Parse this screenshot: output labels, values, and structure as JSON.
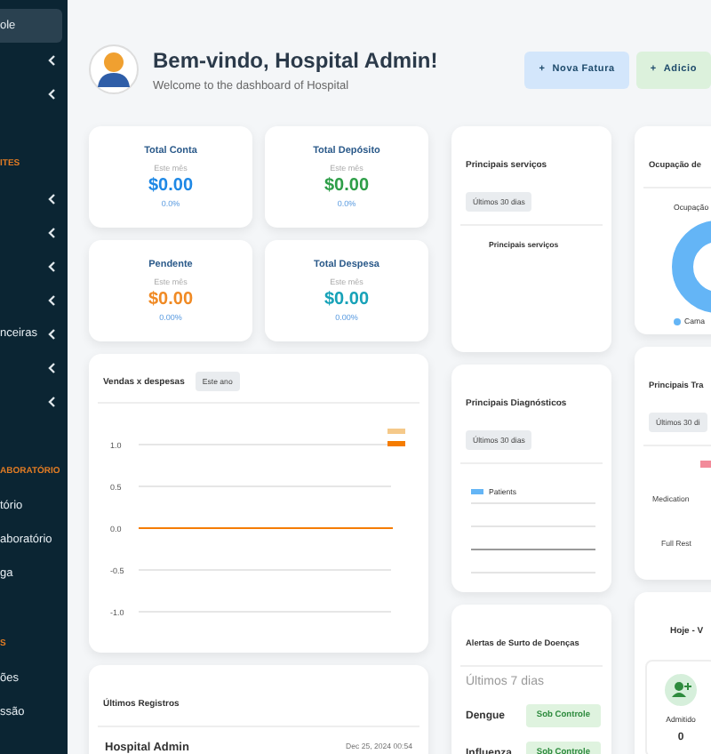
{
  "sidebar": {
    "items": [
      {
        "kind": "item",
        "label": "ole",
        "chevron": false,
        "selected": true
      },
      {
        "kind": "item",
        "chevron": true,
        "selected": false
      },
      {
        "kind": "item",
        "chevron": true,
        "selected": false
      },
      {
        "kind": "section",
        "label": "ITES"
      },
      {
        "kind": "item",
        "chevron": true,
        "selected": false
      },
      {
        "kind": "item",
        "chevron": true,
        "selected": false
      },
      {
        "kind": "item",
        "chevron": true,
        "selected": false
      },
      {
        "kind": "item",
        "chevron": true,
        "selected": false
      },
      {
        "kind": "item",
        "label": "nceiras",
        "chevron": true,
        "selected": false
      },
      {
        "kind": "item",
        "chevron": true,
        "selected": false
      },
      {
        "kind": "item",
        "chevron": true,
        "selected": false
      },
      {
        "kind": "section",
        "label": "ABORATÓRIO"
      },
      {
        "kind": "item",
        "label": "tório",
        "chevron": false,
        "selected": false
      },
      {
        "kind": "item",
        "label": "aboratório",
        "chevron": false,
        "selected": false
      },
      {
        "kind": "item",
        "label": "ga",
        "chevron": false,
        "selected": false
      },
      {
        "kind": "section",
        "label": "S"
      },
      {
        "kind": "item",
        "label": "ões",
        "chevron": false,
        "selected": false
      },
      {
        "kind": "item",
        "label": "ssão",
        "chevron": false,
        "selected": false
      }
    ]
  },
  "header": {
    "title": "Bem-vindo, Hospital Admin!",
    "subtitle": "Welcome to the dashboard of Hospital",
    "buttons": [
      {
        "icon": "+",
        "label": "Nova Fatura",
        "color": "#d3e6fb"
      },
      {
        "icon": "+",
        "label": "Adicio",
        "color": "#dcf1dc"
      }
    ]
  },
  "stats": [
    {
      "title": "Total Conta",
      "period": "Este mês",
      "value": "$0.00",
      "change": "0.0%",
      "color": "#1e88e5"
    },
    {
      "title": "Total Depósito",
      "period": "Este mês",
      "value": "$0.00",
      "change": "0.0%",
      "color": "#2e9e48"
    },
    {
      "title": "Pendente",
      "period": "Este mês",
      "value": "$0.00",
      "change": "0.00%",
      "color": "#f08a24"
    },
    {
      "title": "Total Despesa",
      "period": "Este mês",
      "value": "$0.00",
      "change": "0.00%",
      "color": "#17a2b8"
    }
  ],
  "sales": {
    "title": "Vendas x despesas",
    "badge": "Este ano",
    "chart_data": {
      "type": "line",
      "ylim": [
        -1,
        1
      ],
      "yticks": [
        {
          "value": 1,
          "label": "1.0"
        },
        {
          "value": 0.5,
          "label": "0.5"
        },
        {
          "value": 0,
          "label": "0.0"
        },
        {
          "value": -0.5,
          "label": "-0.5"
        },
        {
          "value": -1,
          "label": "-1.0"
        }
      ],
      "series": [
        {
          "color": "#f5c98a",
          "values": [
            0,
            0,
            0,
            0,
            0,
            0,
            0,
            0,
            0,
            0,
            0,
            0
          ]
        },
        {
          "color": "#f57c00",
          "values": [
            0,
            0,
            0,
            0,
            0,
            0,
            0,
            0,
            0,
            0,
            0,
            0
          ]
        }
      ]
    }
  },
  "records": {
    "title": "Últimos Registros",
    "items": [
      {
        "name": "Hospital Admin",
        "date": "Dec 25, 2024 00:54"
      }
    ]
  },
  "services": {
    "title": "Principais serviços",
    "badge": "Últimos 30 dias",
    "chart_title": "Principais serviços"
  },
  "diagnostics": {
    "title": "Principais Diagnósticos",
    "badge": "Últimos 30 dias",
    "legend": "Patients"
  },
  "outbreaks": {
    "title": "Alertas de Surto de Doenças",
    "period": "Últimos 7 dias",
    "items": [
      {
        "disease": "Dengue",
        "status": "Sob Controle"
      },
      {
        "disease": "Influenza",
        "status": "Sob Controle"
      }
    ]
  },
  "occupancy": {
    "title": "Ocupação de",
    "chart_title": "Ocupação",
    "legend": "Cama"
  },
  "treatments": {
    "title": "Principais Tra",
    "badge": "Últimos 30 di",
    "labels": [
      "Medication",
      "Full Rest"
    ]
  },
  "today": {
    "title": "Hoje - V",
    "label": "Admitido",
    "value": "0"
  }
}
